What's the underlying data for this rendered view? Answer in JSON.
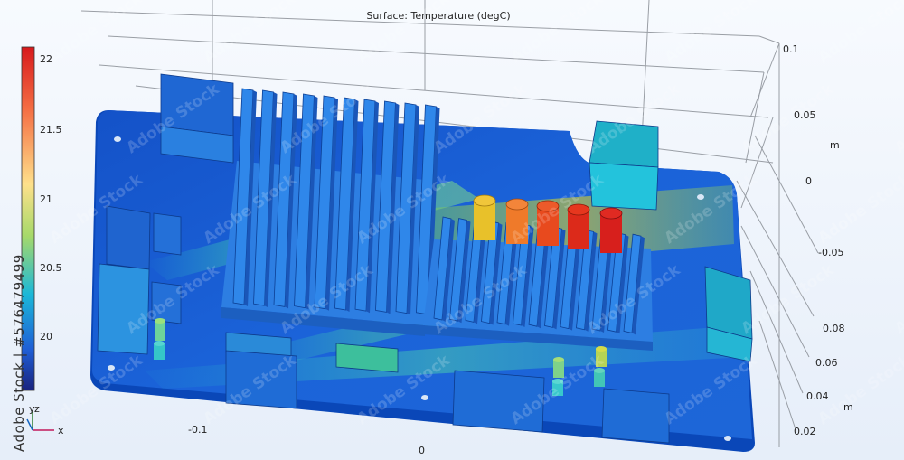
{
  "chart_data": {
    "type": "heatmap",
    "title": "Surface: Temperature (degC)",
    "colorbar": {
      "ticks": [
        "22",
        "21.5",
        "21",
        "20.5",
        "20"
      ],
      "colors": [
        "#d7191c",
        "#f46d43",
        "#fee08b",
        "#a6d96a",
        "#1bb8d8",
        "#1f5fd6",
        "#1a237e"
      ]
    },
    "axes": {
      "x_ticks": [
        "-0.1",
        "0"
      ],
      "y_ticks": [
        "0.08",
        "0.06",
        "0.04",
        "0.02"
      ],
      "y_unit": "m",
      "z_ticks": [
        "0.1",
        "0.05",
        "0",
        "-0.05"
      ],
      "z_unit": "m"
    },
    "triad": {
      "x": "x",
      "y": "y",
      "z": "z"
    },
    "background": [
      "#e9f1fb",
      "#f7fafe"
    ]
  },
  "watermark": {
    "text": "Adobe Stock",
    "side_text": "Adobe Stock | #576479499"
  }
}
